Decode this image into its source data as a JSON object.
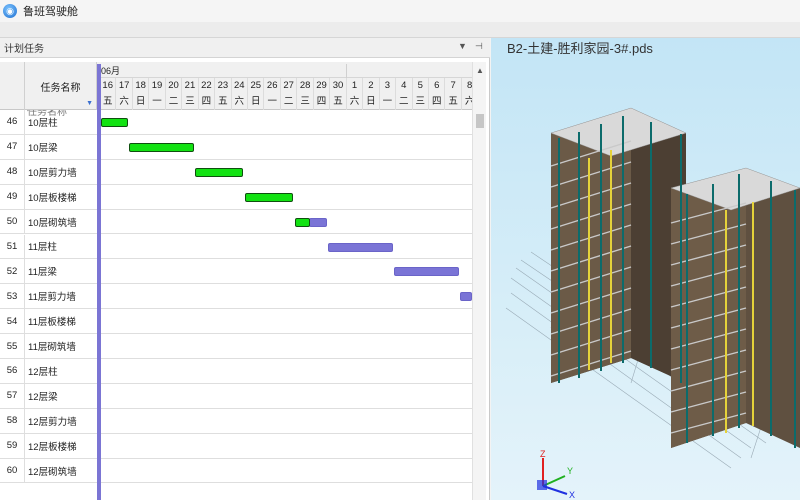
{
  "window": {
    "title": "鲁班驾驶舱"
  },
  "left_panel": {
    "title": "计划任务",
    "dropdown_icon": "▼",
    "pin_icon": "⊣",
    "columns": {
      "name_header": "任务名称"
    },
    "month_label": "06月",
    "days": [
      "16",
      "17",
      "18",
      "19",
      "20",
      "21",
      "22",
      "23",
      "24",
      "25",
      "26",
      "27",
      "28",
      "29",
      "30",
      "1",
      "2",
      "3",
      "4",
      "5",
      "6",
      "7",
      "8"
    ],
    "weekdays": [
      "五",
      "六",
      "日",
      "一",
      "二",
      "三",
      "四",
      "五",
      "六",
      "日",
      "一",
      "二",
      "三",
      "四",
      "五",
      "六",
      "日",
      "一",
      "二",
      "三",
      "四",
      "五",
      "六"
    ],
    "peek_text": "任务名称",
    "tasks": [
      {
        "id": "46",
        "name": "10层柱"
      },
      {
        "id": "47",
        "name": "10层梁"
      },
      {
        "id": "48",
        "name": "10层剪力墙"
      },
      {
        "id": "49",
        "name": "10层板楼梯"
      },
      {
        "id": "50",
        "name": "10层砌筑墙"
      },
      {
        "id": "51",
        "name": "11层柱"
      },
      {
        "id": "52",
        "name": "11层梁"
      },
      {
        "id": "53",
        "name": "11层剪力墙"
      },
      {
        "id": "54",
        "name": "11层板楼梯"
      },
      {
        "id": "55",
        "name": "11层砌筑墙"
      },
      {
        "id": "56",
        "name": "12层柱"
      },
      {
        "id": "57",
        "name": "12层梁"
      },
      {
        "id": "58",
        "name": "12层剪力墙"
      },
      {
        "id": "59",
        "name": "12层板楼梯"
      },
      {
        "id": "60",
        "name": "12层砌筑墙"
      }
    ]
  },
  "right_panel": {
    "document_title": "B2-土建-胜利家园-3#.pds",
    "axis_labels": {
      "z": "Z",
      "y": "Y",
      "x": "X"
    }
  },
  "colors": {
    "actual_bar": "#12e212",
    "planned_bar": "#7a74d6",
    "today_line": "#7b75d4"
  }
}
